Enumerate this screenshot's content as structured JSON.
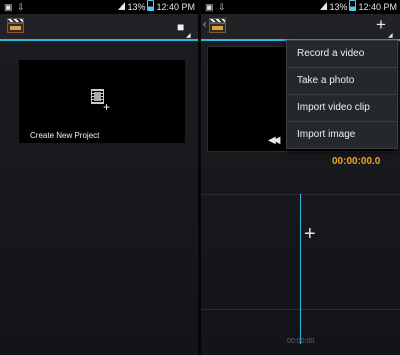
{
  "left_panel": {
    "status": {
      "battery": "13%",
      "time": "12:40",
      "period": "PM"
    },
    "create_project_label": "Create New Project"
  },
  "right_panel": {
    "status": {
      "battery": "13%",
      "time": "12:40",
      "period": "PM"
    },
    "timecode": "00:00:00.0",
    "timeline_ruler": "00:00:00",
    "menu": {
      "items": [
        "Record a video",
        "Take a photo",
        "Import video clip",
        "Import image"
      ]
    }
  },
  "icons": {
    "app": "clapperboard-icon",
    "add_project": "add-project-icon",
    "add_media": "add-media-icon",
    "rewind": "rewind-icon",
    "add_clip": "add-clip-icon",
    "film": "film-plus-icon"
  },
  "colors": {
    "accent": "#33b5e5",
    "timecode": "#f2a31e",
    "background": "#15171a"
  }
}
